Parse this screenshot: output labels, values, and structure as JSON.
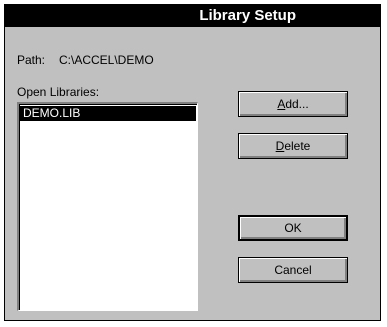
{
  "dialog": {
    "title": "Library Setup"
  },
  "path": {
    "label": "Path:",
    "value": "C:\\ACCEL\\DEMO"
  },
  "libraries": {
    "label": "Open Libraries:",
    "items": [
      {
        "name": "DEMO.LIB",
        "selected": true
      }
    ]
  },
  "buttons": {
    "add": {
      "mnemonic": "A",
      "rest": "dd..."
    },
    "delete": {
      "mnemonic": "D",
      "rest": "elete"
    },
    "ok": {
      "label": "OK"
    },
    "cancel": {
      "label": "Cancel"
    }
  },
  "colors": {
    "dialog_bg": "#c0c0c0",
    "title_bg": "#000000",
    "title_fg": "#ffffff",
    "selection_bg": "#000000"
  }
}
